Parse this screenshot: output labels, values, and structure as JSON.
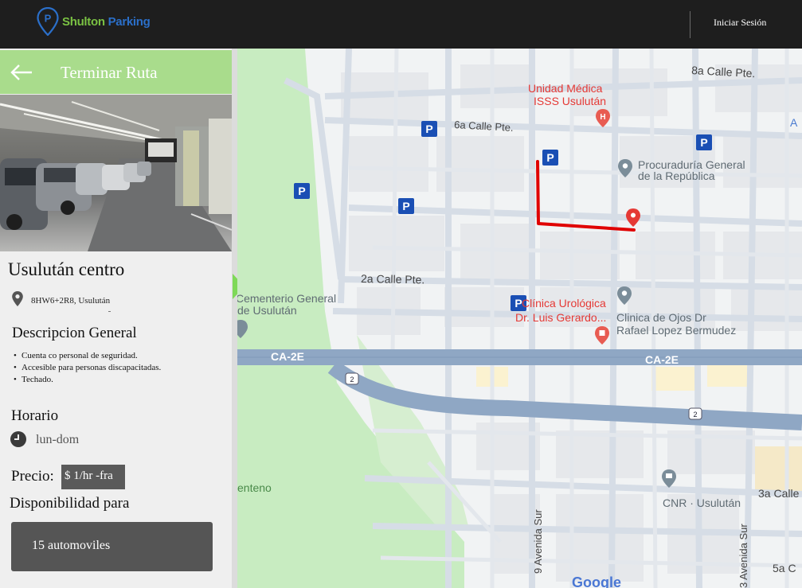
{
  "header": {
    "logo_part1": "Shulton",
    "logo_part2": "Parking",
    "login_label": "Iniciar Sesión"
  },
  "panel": {
    "header_title": "Terminar Ruta",
    "place_name": "Usulután centro",
    "address": "8HW6+2R8, Usulután",
    "description_title": "Descripcion General",
    "description_items": [
      "Cuenta co personal de seguridad.",
      "Accesible para personas discapacitadas.",
      "Techado."
    ],
    "horario_title": "Horario",
    "horario_value": "lun-dom",
    "precio_label": "Precio:",
    "precio_value": "$ 1/hr -fra",
    "disponibilidad_label": "Disponibilidad para",
    "disponibilidad_value": "15 automoviles"
  },
  "map": {
    "labels": {
      "calle_8a": "8a Calle Pte.",
      "calle_6a": "6a Calle Pte.",
      "calle_2a": "2a Calle Pte.",
      "calle_3a": "3a Calle",
      "calle_5a": "5a C",
      "unidad_medica_1": "Unidad Médica",
      "unidad_medica_2": "ISSS Usulután",
      "procuraduria_1": "Procuraduría General",
      "procuraduria_2": "de la República",
      "cementerio_1": "Cementerio General",
      "cementerio_2": "de Usulután",
      "clinica_uro_1": "Clínica Urológica",
      "clinica_uro_2": "Dr. Luis Gerardo...",
      "clinica_ojos_1": "Clinica de Ojos Dr",
      "clinica_ojos_2": "Rafael Lopez Bermudez",
      "ca2e_a": "CA-2E",
      "ca2e_b": "CA-2E",
      "shield_2": "2",
      "centeno": "enteno",
      "cnr": "CNR · Usulután",
      "avenida_9": "9 Avenida Sur",
      "avenida_3": "3 Avenida Sur",
      "edge_a": "A",
      "google": "Google"
    },
    "parking_letter": "P",
    "colors": {
      "route": "#e00000",
      "parking_marker": "#1a4fb4",
      "destination_pin": "#e53935",
      "park_green": "#c8ecc1",
      "highway": "#8fa7c4",
      "street": "#d8dee6"
    }
  },
  "icons": {
    "back": "back-arrow-icon",
    "location": "location-pin-icon",
    "clock": "clock-icon",
    "collapse": "collapse-panel-icon"
  }
}
